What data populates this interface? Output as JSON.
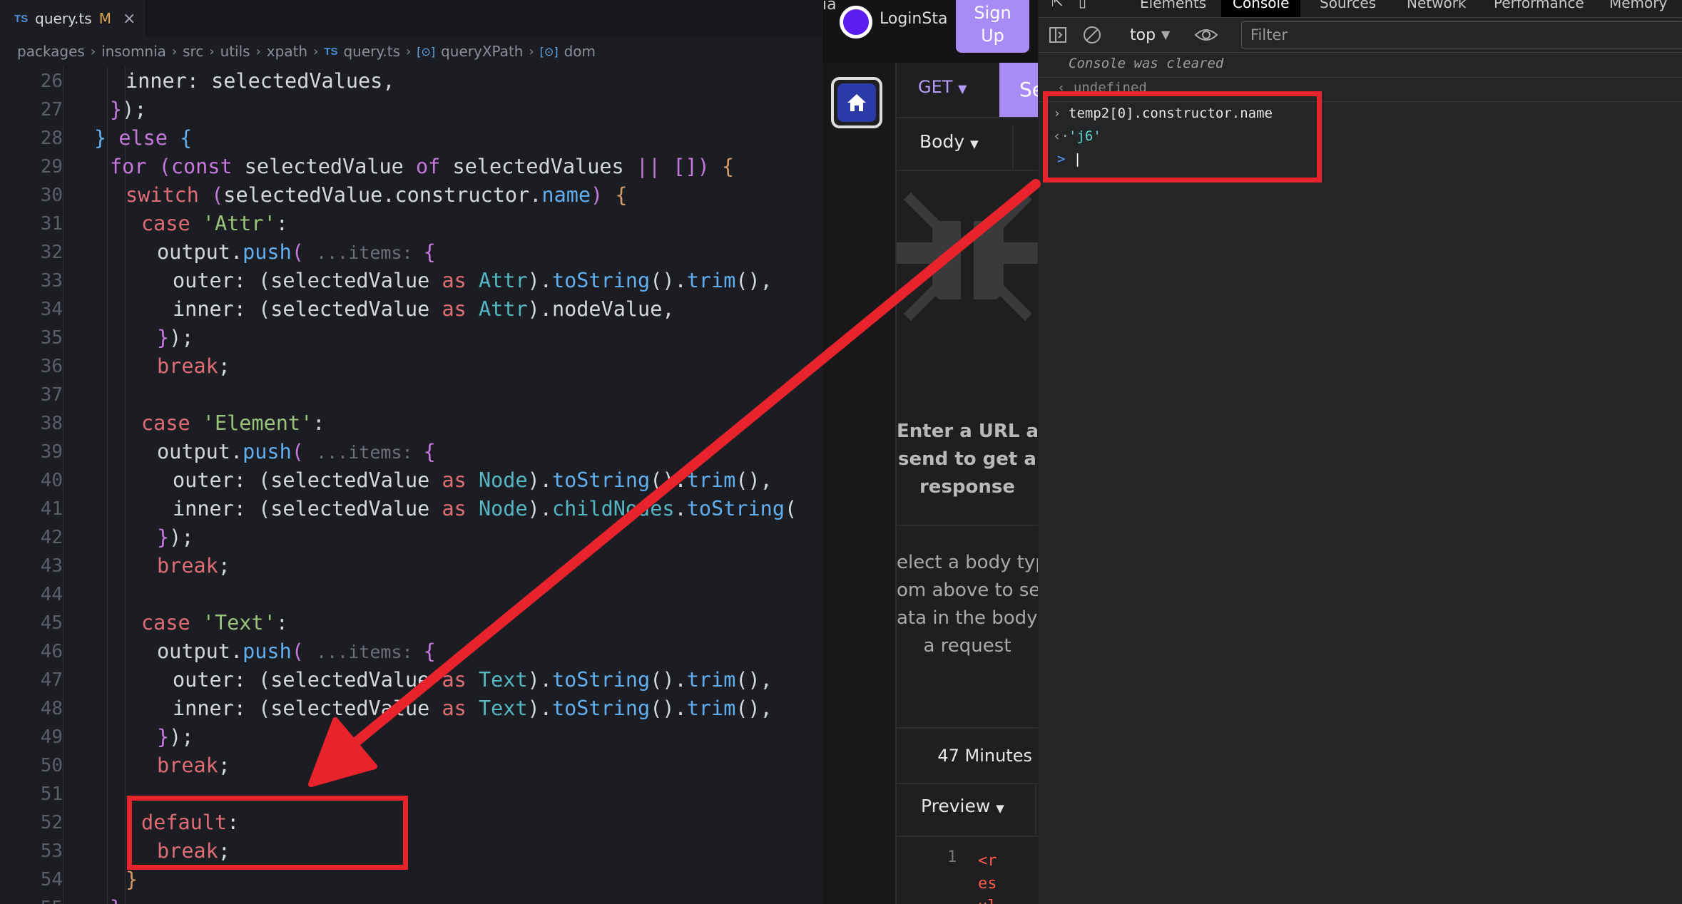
{
  "editor": {
    "tab": {
      "lang": "TS",
      "name": "query.ts",
      "modified": "M",
      "close": "×"
    },
    "breadcrumb": [
      {
        "label": "packages",
        "icon": ""
      },
      {
        "label": "insomnia",
        "icon": ""
      },
      {
        "label": "src",
        "icon": ""
      },
      {
        "label": "utils",
        "icon": ""
      },
      {
        "label": "xpath",
        "icon": ""
      },
      {
        "label": "query.ts",
        "icon": "TS"
      },
      {
        "label": "queryXPath",
        "icon": "[⊙]"
      },
      {
        "label": "dom",
        "icon": "[⊙]"
      }
    ],
    "lines": [
      {
        "n": "26",
        "indent": 3,
        "t": [
          [
            "pl",
            "inner: selectedValues,"
          ]
        ]
      },
      {
        "n": "27",
        "indent": 2,
        "t": [
          [
            "kwp",
            "}"
          ],
          [
            "pl",
            ");"
          ]
        ]
      },
      {
        "n": "28",
        "indent": 1,
        "t": [
          [
            "fn",
            "} "
          ],
          [
            "kwp",
            "else "
          ],
          [
            "fn",
            "{"
          ]
        ]
      },
      {
        "n": "29",
        "indent": 2,
        "t": [
          [
            "kwp",
            "for "
          ],
          [
            "kwp",
            "("
          ],
          [
            "kwp",
            "const "
          ],
          [
            "pl",
            "selectedValue "
          ],
          [
            "kwp",
            "of "
          ],
          [
            "pl",
            "selectedValues "
          ],
          [
            "kwp",
            "|| "
          ],
          [
            "kwp",
            "[]"
          ],
          [
            "kwp",
            ") "
          ],
          [
            "br",
            "{"
          ]
        ]
      },
      {
        "n": "30",
        "indent": 3,
        "t": [
          [
            "kw",
            "switch "
          ],
          [
            "kwp",
            "("
          ],
          [
            "pl",
            "selectedValue.constructor."
          ],
          [
            "fn",
            "name"
          ],
          [
            "kwp",
            ") "
          ],
          [
            "br",
            "{"
          ]
        ]
      },
      {
        "n": "31",
        "indent": 4,
        "t": [
          [
            "kw",
            "case "
          ],
          [
            "str",
            "'Attr'"
          ],
          [
            "pl",
            ":"
          ]
        ]
      },
      {
        "n": "32",
        "indent": 5,
        "t": [
          [
            "pl",
            "output."
          ],
          [
            "fn",
            "push"
          ],
          [
            "kwp",
            "( "
          ],
          [
            "hint",
            "...items: "
          ],
          [
            "kwp",
            "{"
          ]
        ]
      },
      {
        "n": "33",
        "indent": 6,
        "t": [
          [
            "pl",
            "outer: (selectedValue "
          ],
          [
            "kw",
            "as "
          ],
          [
            "ty",
            "Attr"
          ],
          [
            "pl",
            ")."
          ],
          [
            "fn",
            "toString"
          ],
          [
            "pl",
            "()."
          ],
          [
            "fn",
            "trim"
          ],
          [
            "pl",
            "(),"
          ]
        ]
      },
      {
        "n": "34",
        "indent": 6,
        "t": [
          [
            "pl",
            "inner: (selectedValue "
          ],
          [
            "kw",
            "as "
          ],
          [
            "ty",
            "Attr"
          ],
          [
            "pl",
            ").nodeValue,"
          ]
        ]
      },
      {
        "n": "35",
        "indent": 5,
        "t": [
          [
            "kwp",
            "}"
          ],
          [
            "pl",
            ");"
          ]
        ]
      },
      {
        "n": "36",
        "indent": 5,
        "t": [
          [
            "kw",
            "break"
          ],
          [
            "pl",
            ";"
          ]
        ]
      },
      {
        "n": "37",
        "indent": 0,
        "t": []
      },
      {
        "n": "38",
        "indent": 4,
        "t": [
          [
            "kw",
            "case "
          ],
          [
            "str",
            "'Element'"
          ],
          [
            "pl",
            ":"
          ]
        ]
      },
      {
        "n": "39",
        "indent": 5,
        "t": [
          [
            "pl",
            "output."
          ],
          [
            "fn",
            "push"
          ],
          [
            "kwp",
            "( "
          ],
          [
            "hint",
            "...items: "
          ],
          [
            "kwp",
            "{"
          ]
        ]
      },
      {
        "n": "40",
        "indent": 6,
        "t": [
          [
            "pl",
            "outer: (selectedValue "
          ],
          [
            "kw",
            "as "
          ],
          [
            "ty",
            "Node"
          ],
          [
            "pl",
            ")."
          ],
          [
            "fn",
            "toString"
          ],
          [
            "pl",
            "()."
          ],
          [
            "fn",
            "trim"
          ],
          [
            "pl",
            "(),"
          ]
        ]
      },
      {
        "n": "41",
        "indent": 6,
        "t": [
          [
            "pl",
            "inner: (selectedValue "
          ],
          [
            "kw",
            "as "
          ],
          [
            "ty",
            "Node"
          ],
          [
            "pl",
            ")."
          ],
          [
            "ty",
            "childNodes"
          ],
          [
            "pl",
            "."
          ],
          [
            "fn",
            "toString"
          ],
          [
            "pl",
            "("
          ]
        ]
      },
      {
        "n": "42",
        "indent": 5,
        "t": [
          [
            "kwp",
            "}"
          ],
          [
            "pl",
            ");"
          ]
        ]
      },
      {
        "n": "43",
        "indent": 5,
        "t": [
          [
            "kw",
            "break"
          ],
          [
            "pl",
            ";"
          ]
        ]
      },
      {
        "n": "44",
        "indent": 0,
        "t": []
      },
      {
        "n": "45",
        "indent": 4,
        "t": [
          [
            "kw",
            "case "
          ],
          [
            "str",
            "'Text'"
          ],
          [
            "pl",
            ":"
          ]
        ]
      },
      {
        "n": "46",
        "indent": 5,
        "t": [
          [
            "pl",
            "output."
          ],
          [
            "fn",
            "push"
          ],
          [
            "kwp",
            "( "
          ],
          [
            "hint",
            "...items: "
          ],
          [
            "kwp",
            "{"
          ]
        ]
      },
      {
        "n": "47",
        "indent": 6,
        "t": [
          [
            "pl",
            "outer: (selectedValue "
          ],
          [
            "kw",
            "as "
          ],
          [
            "ty",
            "Text"
          ],
          [
            "pl",
            ")."
          ],
          [
            "fn",
            "toString"
          ],
          [
            "pl",
            "()."
          ],
          [
            "fn",
            "trim"
          ],
          [
            "pl",
            "(),"
          ]
        ]
      },
      {
        "n": "48",
        "indent": 6,
        "t": [
          [
            "pl",
            "inner: (selectedValue "
          ],
          [
            "kw",
            "as "
          ],
          [
            "ty",
            "Text"
          ],
          [
            "pl",
            ")."
          ],
          [
            "fn",
            "toString"
          ],
          [
            "pl",
            "()."
          ],
          [
            "fn",
            "trim"
          ],
          [
            "pl",
            "(),"
          ]
        ]
      },
      {
        "n": "49",
        "indent": 5,
        "t": [
          [
            "kwp",
            "}"
          ],
          [
            "pl",
            ");"
          ]
        ]
      },
      {
        "n": "50",
        "indent": 5,
        "t": [
          [
            "kw",
            "break"
          ],
          [
            "pl",
            ";"
          ]
        ]
      },
      {
        "n": "51",
        "indent": 0,
        "t": []
      },
      {
        "n": "52",
        "indent": 4,
        "t": [
          [
            "kw",
            "default"
          ],
          [
            "pl",
            ":"
          ]
        ]
      },
      {
        "n": "53",
        "indent": 5,
        "t": [
          [
            "kw",
            "break"
          ],
          [
            "pl",
            ";"
          ]
        ]
      },
      {
        "n": "54",
        "indent": 3,
        "t": [
          [
            "br",
            "}"
          ]
        ]
      },
      {
        "n": "55",
        "indent": 2,
        "t": [
          [
            "kwp",
            "}"
          ]
        ]
      }
    ]
  },
  "insomnia": {
    "top_cut": "ia",
    "login": "LoginSta",
    "signup": [
      "Sign",
      "Up"
    ],
    "method": "GET",
    "send_cut": "Se",
    "body_tab": "Body",
    "empty_message": [
      "Enter a URL and",
      "send to get a",
      "response"
    ],
    "body_message": [
      "elect a body typ",
      "om above to sen",
      "ata in the body o",
      "a request"
    ],
    "elapsed": "47 Minutes",
    "preview_tab": "Preview",
    "response_line_no": "1",
    "response_text": "<r\nes\nul"
  },
  "devtools": {
    "tabs": [
      "Elements",
      "Console",
      "Sources",
      "Network",
      "Performance",
      "Memory"
    ],
    "active_tab": "Console",
    "context": "top",
    "filter_placeholder": "Filter",
    "cleared": "Console was cleared",
    "undefined_line": "undefined",
    "input_line": "temp2[0].constructor.name",
    "output_line": "'j6'",
    "prompt": ">"
  },
  "colors": {
    "annotation_red": "#e8232b",
    "accent_purple": "#a98bf5"
  }
}
